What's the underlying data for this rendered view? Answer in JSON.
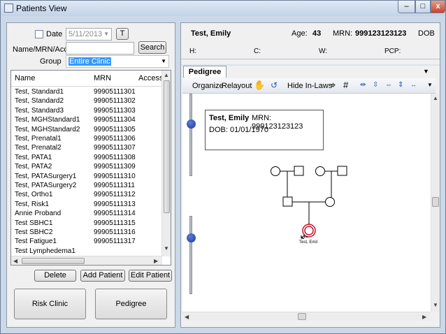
{
  "window": {
    "title": "Patients View",
    "min": "–",
    "max": "□",
    "close": "x"
  },
  "search": {
    "date_label": "Date",
    "date_value": "5/11/2013",
    "t_button": "T",
    "name_label": "Name/MRN/Accn",
    "name_value": "",
    "search_button": "Search",
    "group_label": "Group",
    "group_value": "Entire Clinic"
  },
  "patients": {
    "columns": [
      "Name",
      "MRN",
      "Accession"
    ],
    "rows": [
      [
        "Test, Standard1",
        "99905111301"
      ],
      [
        "Test, Standard2",
        "99905111302"
      ],
      [
        "Test, Standard3",
        "99905111303"
      ],
      [
        "Test, MGHStandard1",
        "99905111304"
      ],
      [
        "Test, MGHStandard2",
        "99905111305"
      ],
      [
        "Test, Prenatal1",
        "99905111306"
      ],
      [
        "Test, Prenatal2",
        "99905111307"
      ],
      [
        "Test, PATA1",
        "99905111308"
      ],
      [
        "Test, PATA2",
        "99905111309"
      ],
      [
        "Test, PATASurgery1",
        "99905111310"
      ],
      [
        "Test, PATASurgery2",
        "99905111311"
      ],
      [
        "Test, Ortho1",
        "99905111312"
      ],
      [
        "Test, Risk1",
        "99905111313"
      ],
      [
        "Annie Proband",
        "99905111314"
      ],
      [
        "Test SBHC1",
        "99905111315"
      ],
      [
        "Test SBHC2",
        "99905111316"
      ],
      [
        "Test Fatigue1",
        "99905111317"
      ],
      [
        "Test Lymphedema1",
        ""
      ]
    ]
  },
  "actions": {
    "delete": "Delete",
    "add": "Add Patient",
    "edit": "Edit Patient",
    "risk": "Risk Clinic",
    "pedigree": "Pedigree"
  },
  "header": {
    "name": "Test, Emily",
    "age_label": "Age:",
    "age": "43",
    "mrn_label": "MRN:",
    "mrn": "999123123123",
    "dob_label": "DOB",
    "h_label": "H:",
    "c_label": "C:",
    "w_label": "W:",
    "pcp_label": "PCP:"
  },
  "pedigree": {
    "tab": "Pedigree",
    "tools": {
      "organize": "Organize",
      "relayout": "Relayout",
      "hide_inlaws": "Hide In-Laws"
    },
    "info_name": "Test, Emily",
    "info_mrn": "MRN: 999123123123",
    "info_dob": "DOB: 01/01/1970",
    "proband_label": "Test, Emil"
  },
  "colors": {
    "knob": "#1a3a9a",
    "selection": "#3399ff",
    "proband": "#c8102e"
  }
}
